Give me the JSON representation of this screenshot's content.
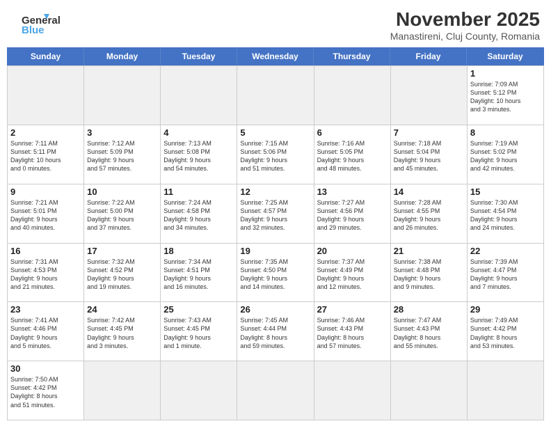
{
  "header": {
    "logo_general": "General",
    "logo_blue": "Blue",
    "month_title": "November 2025",
    "location": "Manastireni, Cluj County, Romania"
  },
  "days_of_week": [
    "Sunday",
    "Monday",
    "Tuesday",
    "Wednesday",
    "Thursday",
    "Friday",
    "Saturday"
  ],
  "weeks": [
    [
      {
        "day": "",
        "empty": true
      },
      {
        "day": "",
        "empty": true
      },
      {
        "day": "",
        "empty": true
      },
      {
        "day": "",
        "empty": true
      },
      {
        "day": "",
        "empty": true
      },
      {
        "day": "",
        "empty": true
      },
      {
        "day": "1",
        "info": "Sunrise: 7:09 AM\nSunset: 5:12 PM\nDaylight: 10 hours\nand 3 minutes."
      }
    ],
    [
      {
        "day": "2",
        "info": "Sunrise: 7:11 AM\nSunset: 5:11 PM\nDaylight: 10 hours\nand 0 minutes."
      },
      {
        "day": "3",
        "info": "Sunrise: 7:12 AM\nSunset: 5:09 PM\nDaylight: 9 hours\nand 57 minutes."
      },
      {
        "day": "4",
        "info": "Sunrise: 7:13 AM\nSunset: 5:08 PM\nDaylight: 9 hours\nand 54 minutes."
      },
      {
        "day": "5",
        "info": "Sunrise: 7:15 AM\nSunset: 5:06 PM\nDaylight: 9 hours\nand 51 minutes."
      },
      {
        "day": "6",
        "info": "Sunrise: 7:16 AM\nSunset: 5:05 PM\nDaylight: 9 hours\nand 48 minutes."
      },
      {
        "day": "7",
        "info": "Sunrise: 7:18 AM\nSunset: 5:04 PM\nDaylight: 9 hours\nand 45 minutes."
      },
      {
        "day": "8",
        "info": "Sunrise: 7:19 AM\nSunset: 5:02 PM\nDaylight: 9 hours\nand 42 minutes."
      }
    ],
    [
      {
        "day": "9",
        "info": "Sunrise: 7:21 AM\nSunset: 5:01 PM\nDaylight: 9 hours\nand 40 minutes."
      },
      {
        "day": "10",
        "info": "Sunrise: 7:22 AM\nSunset: 5:00 PM\nDaylight: 9 hours\nand 37 minutes."
      },
      {
        "day": "11",
        "info": "Sunrise: 7:24 AM\nSunset: 4:58 PM\nDaylight: 9 hours\nand 34 minutes."
      },
      {
        "day": "12",
        "info": "Sunrise: 7:25 AM\nSunset: 4:57 PM\nDaylight: 9 hours\nand 32 minutes."
      },
      {
        "day": "13",
        "info": "Sunrise: 7:27 AM\nSunset: 4:56 PM\nDaylight: 9 hours\nand 29 minutes."
      },
      {
        "day": "14",
        "info": "Sunrise: 7:28 AM\nSunset: 4:55 PM\nDaylight: 9 hours\nand 26 minutes."
      },
      {
        "day": "15",
        "info": "Sunrise: 7:30 AM\nSunset: 4:54 PM\nDaylight: 9 hours\nand 24 minutes."
      }
    ],
    [
      {
        "day": "16",
        "info": "Sunrise: 7:31 AM\nSunset: 4:53 PM\nDaylight: 9 hours\nand 21 minutes."
      },
      {
        "day": "17",
        "info": "Sunrise: 7:32 AM\nSunset: 4:52 PM\nDaylight: 9 hours\nand 19 minutes."
      },
      {
        "day": "18",
        "info": "Sunrise: 7:34 AM\nSunset: 4:51 PM\nDaylight: 9 hours\nand 16 minutes."
      },
      {
        "day": "19",
        "info": "Sunrise: 7:35 AM\nSunset: 4:50 PM\nDaylight: 9 hours\nand 14 minutes."
      },
      {
        "day": "20",
        "info": "Sunrise: 7:37 AM\nSunset: 4:49 PM\nDaylight: 9 hours\nand 12 minutes."
      },
      {
        "day": "21",
        "info": "Sunrise: 7:38 AM\nSunset: 4:48 PM\nDaylight: 9 hours\nand 9 minutes."
      },
      {
        "day": "22",
        "info": "Sunrise: 7:39 AM\nSunset: 4:47 PM\nDaylight: 9 hours\nand 7 minutes."
      }
    ],
    [
      {
        "day": "23",
        "info": "Sunrise: 7:41 AM\nSunset: 4:46 PM\nDaylight: 9 hours\nand 5 minutes."
      },
      {
        "day": "24",
        "info": "Sunrise: 7:42 AM\nSunset: 4:45 PM\nDaylight: 9 hours\nand 3 minutes."
      },
      {
        "day": "25",
        "info": "Sunrise: 7:43 AM\nSunset: 4:45 PM\nDaylight: 9 hours\nand 1 minute."
      },
      {
        "day": "26",
        "info": "Sunrise: 7:45 AM\nSunset: 4:44 PM\nDaylight: 8 hours\nand 59 minutes."
      },
      {
        "day": "27",
        "info": "Sunrise: 7:46 AM\nSunset: 4:43 PM\nDaylight: 8 hours\nand 57 minutes."
      },
      {
        "day": "28",
        "info": "Sunrise: 7:47 AM\nSunset: 4:43 PM\nDaylight: 8 hours\nand 55 minutes."
      },
      {
        "day": "29",
        "info": "Sunrise: 7:49 AM\nSunset: 4:42 PM\nDaylight: 8 hours\nand 53 minutes."
      }
    ],
    [
      {
        "day": "30",
        "info": "Sunrise: 7:50 AM\nSunset: 4:42 PM\nDaylight: 8 hours\nand 51 minutes."
      },
      {
        "day": "",
        "empty": true
      },
      {
        "day": "",
        "empty": true
      },
      {
        "day": "",
        "empty": true
      },
      {
        "day": "",
        "empty": true
      },
      {
        "day": "",
        "empty": true
      },
      {
        "day": "",
        "empty": true
      }
    ]
  ]
}
